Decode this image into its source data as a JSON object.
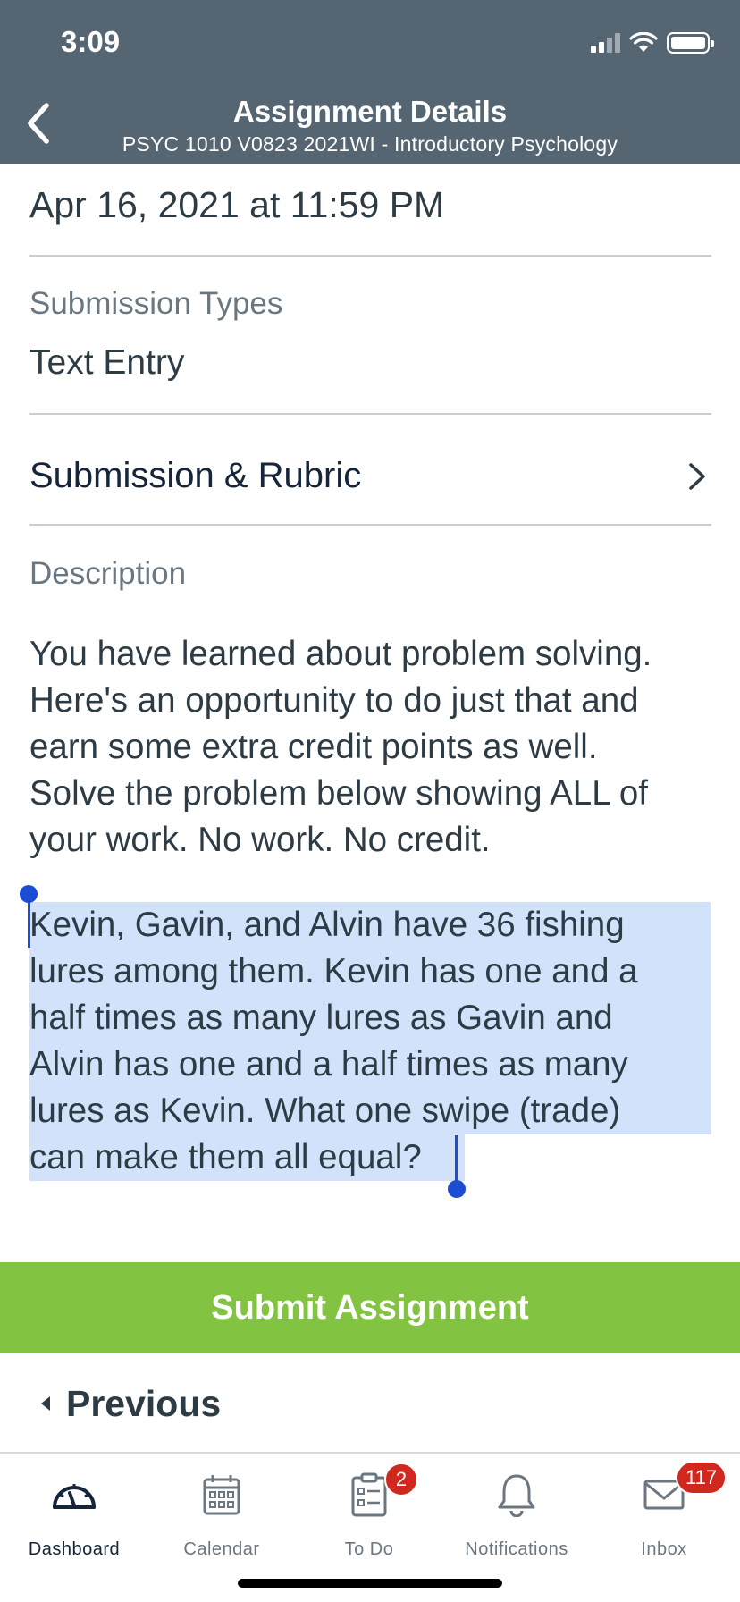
{
  "status_bar": {
    "time": "3:09"
  },
  "header": {
    "title": "Assignment Details",
    "subtitle": "PSYC 1010 V0823 2021WI - Introductory Psychology"
  },
  "due": {
    "date": "Apr 16, 2021 at 11:59 PM"
  },
  "submission_types": {
    "label": "Submission Types",
    "value": "Text Entry"
  },
  "rubric": {
    "label": "Submission & Rubric"
  },
  "description": {
    "label": "Description",
    "paragraph1_lines": [
      "You have learned about problem solving.",
      "Here's an opportunity to do just that and",
      "earn some extra credit points as well.",
      "Solve the problem below showing ALL of",
      "your work.  No work.  No credit."
    ],
    "paragraph2_lines": [
      "Kevin, Gavin, and Alvin have 36 fishing",
      "lures among them.  Kevin has one and a",
      "half times as many lures as Gavin and",
      "Alvin has one and a half times as many",
      "lures as Kevin.  What one swipe (trade)",
      "can make them all equal?"
    ]
  },
  "submit_button": {
    "label": "Submit Assignment"
  },
  "previous_button": {
    "label": "Previous"
  },
  "tabs": [
    {
      "label": "Dashboard",
      "icon": "dashboard-icon",
      "active": true
    },
    {
      "label": "Calendar",
      "icon": "calendar-icon"
    },
    {
      "label": "To Do",
      "icon": "todo-icon",
      "badge": "2"
    },
    {
      "label": "Notifications",
      "icon": "bell-icon"
    },
    {
      "label": "Inbox",
      "icon": "mail-icon",
      "badge": "117"
    }
  ],
  "colors": {
    "header_bg": "#556572",
    "submit_bg": "#82c341",
    "highlight": "#d1e2fa",
    "selection_handle": "#1d4cd4",
    "badge": "#d0281f"
  }
}
